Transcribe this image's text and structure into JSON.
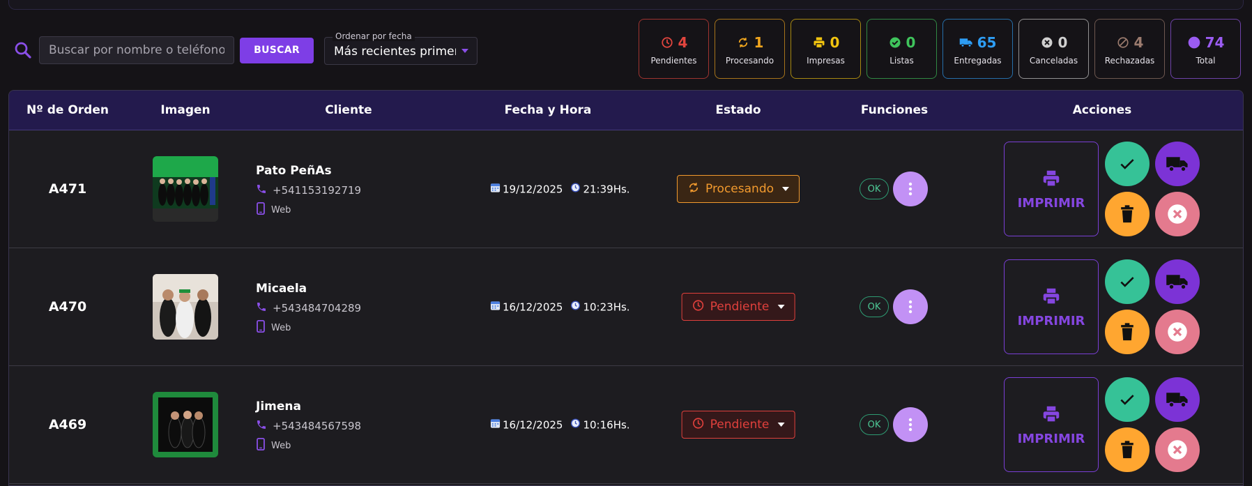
{
  "search": {
    "placeholder": "Buscar por nombre o teléfono...",
    "button_label": "BUSCAR"
  },
  "sort": {
    "label": "Ordenar por fecha",
    "value": "Más recientes primero"
  },
  "stats": [
    {
      "label": "Pendientes",
      "count": "4",
      "color": "#e2453e",
      "icon": "clock-icon"
    },
    {
      "label": "Procesando",
      "count": "1",
      "color": "#f0a51e",
      "icon": "sync-icon"
    },
    {
      "label": "Impresas",
      "count": "0",
      "color": "#f1c40f",
      "icon": "printer-icon"
    },
    {
      "label": "Listas",
      "count": "0",
      "color": "#3fc45c",
      "icon": "check-circle-icon"
    },
    {
      "label": "Entregadas",
      "count": "65",
      "color": "#2e9ef5",
      "icon": "truck-icon"
    },
    {
      "label": "Canceladas",
      "count": "0",
      "color": "#d0d0d0",
      "icon": "x-circle-icon"
    },
    {
      "label": "Rechazadas",
      "count": "4",
      "color": "#9b7b6e",
      "icon": "ban-icon"
    },
    {
      "label": "Total",
      "count": "74",
      "color": "#9b5cf2",
      "icon": "dot-icon"
    }
  ],
  "table": {
    "headers": [
      "Nº de Orden",
      "Imagen",
      "Cliente",
      "Fecha y Hora",
      "Estado",
      "Funciones",
      "Acciones"
    ],
    "print_label": "IMPRIMIR",
    "ok_label": "OK",
    "rows": [
      {
        "order": "A471",
        "name": "Pato PeñAs",
        "phone": "+541153192719",
        "source": "Web",
        "date": "19/12/2025",
        "time": "21:39Hs.",
        "status": "Procesando",
        "status_color": "#f29a2e"
      },
      {
        "order": "A470",
        "name": "Micaela",
        "phone": "+543484704289",
        "source": "Web",
        "date": "16/12/2025",
        "time": "10:23Hs.",
        "status": "Pendiente",
        "status_color": "#e0403c"
      },
      {
        "order": "A469",
        "name": "Jimena",
        "phone": "+543484567598",
        "source": "Web",
        "date": "16/12/2025",
        "time": "10:16Hs.",
        "status": "Pendiente",
        "status_color": "#e0403c"
      }
    ]
  },
  "colors": {
    "accent": "#7e3ee6",
    "header_bg": "#231a4d",
    "ok_green": "#4ec996"
  }
}
